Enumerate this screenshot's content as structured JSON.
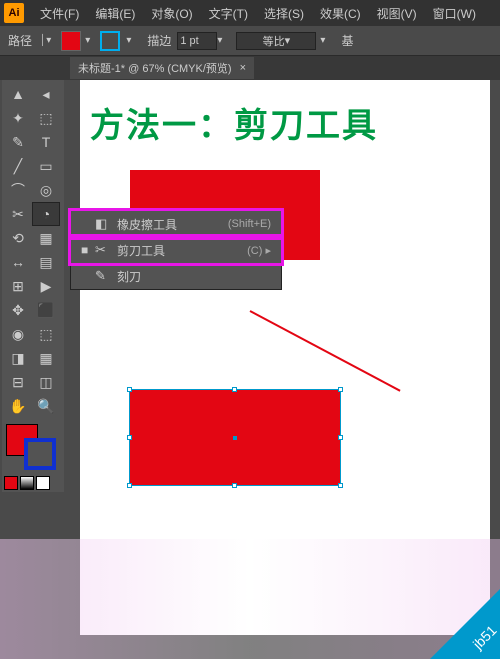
{
  "menubar": {
    "items": [
      "文件(F)",
      "编辑(E)",
      "对象(O)",
      "文字(T)",
      "选择(S)",
      "效果(C)",
      "视图(V)",
      "窗口(W)"
    ]
  },
  "controlbar": {
    "label": "路径",
    "stroke_label": "描边",
    "stroke_value": "1 pt",
    "profile": "等比",
    "align": "基"
  },
  "doc_tab": {
    "title": "未标题-1* @ 67% (CMYK/预览)",
    "close": "×"
  },
  "tools": [
    "▲",
    "◂",
    "✦",
    "⬚",
    "✎",
    "T",
    "╱",
    "▭",
    "⌒",
    "◎",
    "✂",
    "◔",
    "⟲",
    "▦",
    "↔",
    "▤",
    "⊞",
    "▶",
    "✥",
    "⬛",
    "◉",
    "⬚",
    "◨",
    "▦",
    "⊟",
    "◫",
    "⬜",
    "✋",
    "🔍"
  ],
  "flyout": {
    "rows": [
      {
        "sel": "",
        "icon": "◧",
        "label": "橡皮擦工具",
        "shortcut": "(Shift+E)"
      },
      {
        "sel": "■",
        "icon": "✂",
        "label": "剪刀工具",
        "shortcut": "(C) ▸"
      },
      {
        "sel": "",
        "icon": "✎",
        "label": "刻刀",
        "shortcut": ""
      }
    ]
  },
  "canvas": {
    "title": "方法一：剪刀工具"
  },
  "watermark": {
    "badge": "jb51"
  }
}
